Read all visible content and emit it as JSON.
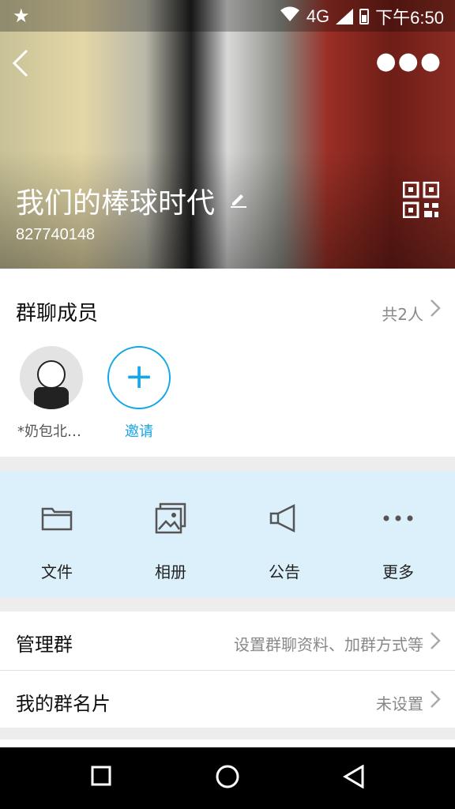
{
  "status_bar": {
    "network": "4G",
    "time": "下午6:50"
  },
  "header": {
    "group_name": "我们的棒球时代",
    "group_id": "827740148"
  },
  "members": {
    "title": "群聊成员",
    "count_label": "共2人",
    "items": [
      {
        "name": "*奶包北…"
      }
    ],
    "invite_label": "邀请"
  },
  "actions": [
    {
      "label": "文件",
      "icon": "folder-icon"
    },
    {
      "label": "相册",
      "icon": "album-icon"
    },
    {
      "label": "公告",
      "icon": "megaphone-icon"
    },
    {
      "label": "更多",
      "icon": "more-icon"
    }
  ],
  "rows": [
    {
      "label": "管理群",
      "value": "设置群聊资料、加群方式等"
    },
    {
      "label": "我的群名片",
      "value": "未设置"
    }
  ],
  "colors": {
    "accent": "#15a6e6",
    "actions_bg": "#dcf0fb"
  }
}
